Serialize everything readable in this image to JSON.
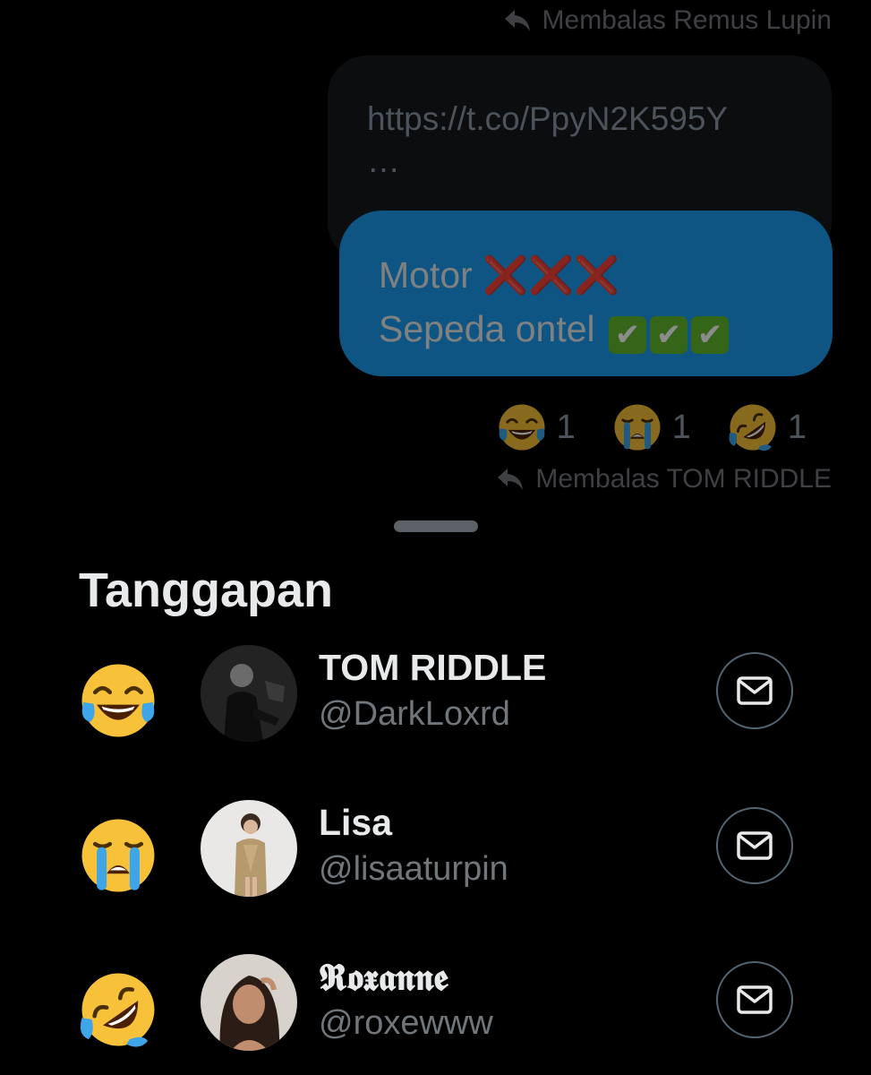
{
  "thread": {
    "reply_to_1": "Membalas Remus Lupin",
    "link_text": "https://t.co/PpyN2K595Y",
    "link_ellipsis": "…",
    "message_line1": "Motor",
    "message_line1_emoji": "❌❌❌",
    "message_line2": "Sepeda ontel",
    "message_line2_emoji": [
      "✔",
      "✔",
      "✔"
    ],
    "reactions": [
      {
        "emoji": "face-with-tears-of-joy",
        "count": "1"
      },
      {
        "emoji": "loudly-crying-face",
        "count": "1"
      },
      {
        "emoji": "rolling-on-the-floor-laughing",
        "count": "1"
      }
    ],
    "reply_to_2": "Membalas TOM RIDDLE"
  },
  "sheet": {
    "title": "Tanggapan",
    "users": [
      {
        "name": "TOM RIDDLE",
        "handle": "@DarkLoxrd",
        "reaction": "face-with-tears-of-joy"
      },
      {
        "name": "Lisa",
        "handle": "@lisaaturpin",
        "reaction": "loudly-crying-face"
      },
      {
        "name": "𝕽𝖔𝖝𝖆𝖓𝖓𝖊",
        "handle": "@roxewww",
        "reaction": "rolling-on-the-floor-laughing"
      }
    ]
  },
  "colors": {
    "background": "#000000",
    "accent": "#1d9bf0",
    "secondary_text": "#71767b",
    "emoji_yellow": "#f7c23a",
    "tear_blue": "#3da5e8"
  },
  "icons": [
    "reply-arrow-icon",
    "envelope-icon"
  ]
}
